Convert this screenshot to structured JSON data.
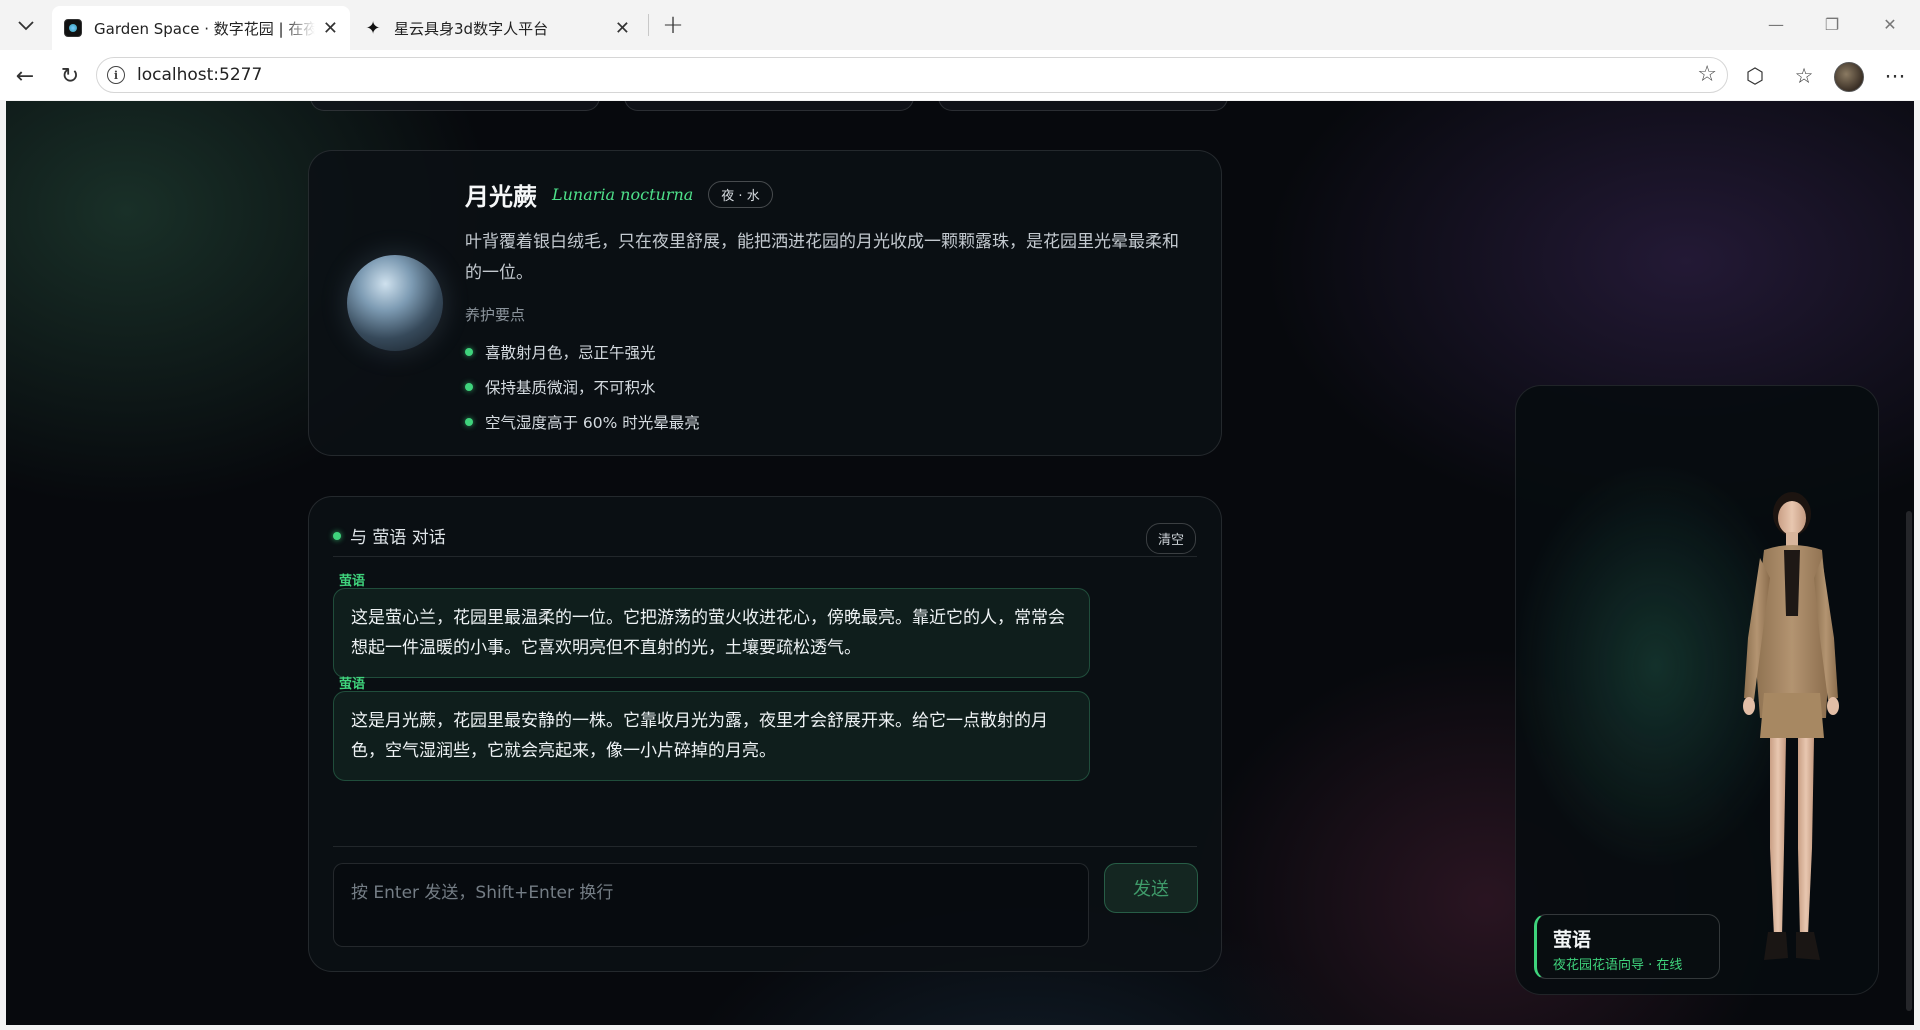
{
  "browser": {
    "tabs": [
      {
        "title": "Garden Space · 数字花园 | 在夜色里"
      },
      {
        "title": "星云具身3d数字人平台"
      }
    ],
    "address": "localhost:5277"
  },
  "plant": {
    "name": "月光蕨",
    "latin": "Lunaria nocturna",
    "tag": "夜 · 水",
    "description": "叶背覆着银白绒毛，只在夜里舒展，能把洒进花园的月光收成一颗颗露珠，是花园里光晕最柔和的一位。",
    "care_title": "养护要点",
    "care": [
      "喜散射月色，忌正午强光",
      "保持基质微润，不可积水",
      "空气湿度高于 60% 时光晕最亮"
    ]
  },
  "chat": {
    "title": "与 萤语 对话",
    "clear_label": "清空",
    "messages": [
      {
        "sender": "萤语",
        "text": "这是萤心兰，花园里最温柔的一位。它把游荡的萤火收进花心，傍晚最亮。靠近它的人，常常会想起一件温暖的小事。它喜欢明亮但不直射的光，土壤要疏松透气。"
      },
      {
        "sender": "萤语",
        "text": "这是月光蕨，花园里最安静的一株。它靠收月光为露，夜里才会舒展开来。给它一点散射的月色，空气湿润些，它就会亮起来，像一小片碎掉的月亮。"
      }
    ],
    "input_placeholder": "按 Enter 发送，Shift+Enter 换行",
    "send_label": "发送"
  },
  "avatar": {
    "name": "萤语",
    "status": "夜花园花语向导 · 在线"
  },
  "colors": {
    "accent": "#3fd37c",
    "page_bg": "#07090d"
  }
}
